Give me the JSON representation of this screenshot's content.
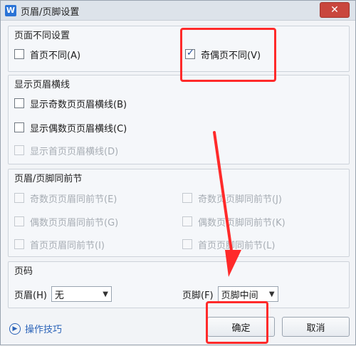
{
  "window": {
    "title": "页眉/页脚设置",
    "app_icon_text": "W",
    "close_glyph": "✕"
  },
  "section1": {
    "title": "页面不同设置",
    "first_page_diff": "首页不同(A)",
    "odd_even_diff": "奇偶页不同(V)"
  },
  "section2": {
    "title": "显示页眉横线",
    "odd_header_line": "显示奇数页页眉横线(B)",
    "even_header_line": "显示偶数页页眉横线(C)",
    "first_header_line": "显示首页页眉横线(D)"
  },
  "section3": {
    "title": "页眉/页脚同前节",
    "odd_header_same": "奇数页页眉同前节(E)",
    "odd_footer_same": "奇数页页脚同前节(J)",
    "even_header_same": "偶数页页眉同前节(G)",
    "even_footer_same": "偶数页页脚同前节(K)",
    "first_header_same": "首页页眉同前节(I)",
    "first_footer_same": "首页页脚同前节(L)"
  },
  "section4": {
    "title": "页码",
    "header_label": "页眉(H)",
    "header_value": "无",
    "footer_label": "页脚(F)",
    "footer_value": "页脚中间"
  },
  "footer": {
    "tips_label": "操作技巧",
    "ok_label": "确定",
    "cancel_label": "取消"
  },
  "colors": {
    "accent": "#2b63b8",
    "annotation": "#ff2a2a"
  },
  "icons": {
    "tips": "play-circle-icon",
    "close": "close-icon",
    "caret": "chevron-down-icon"
  }
}
